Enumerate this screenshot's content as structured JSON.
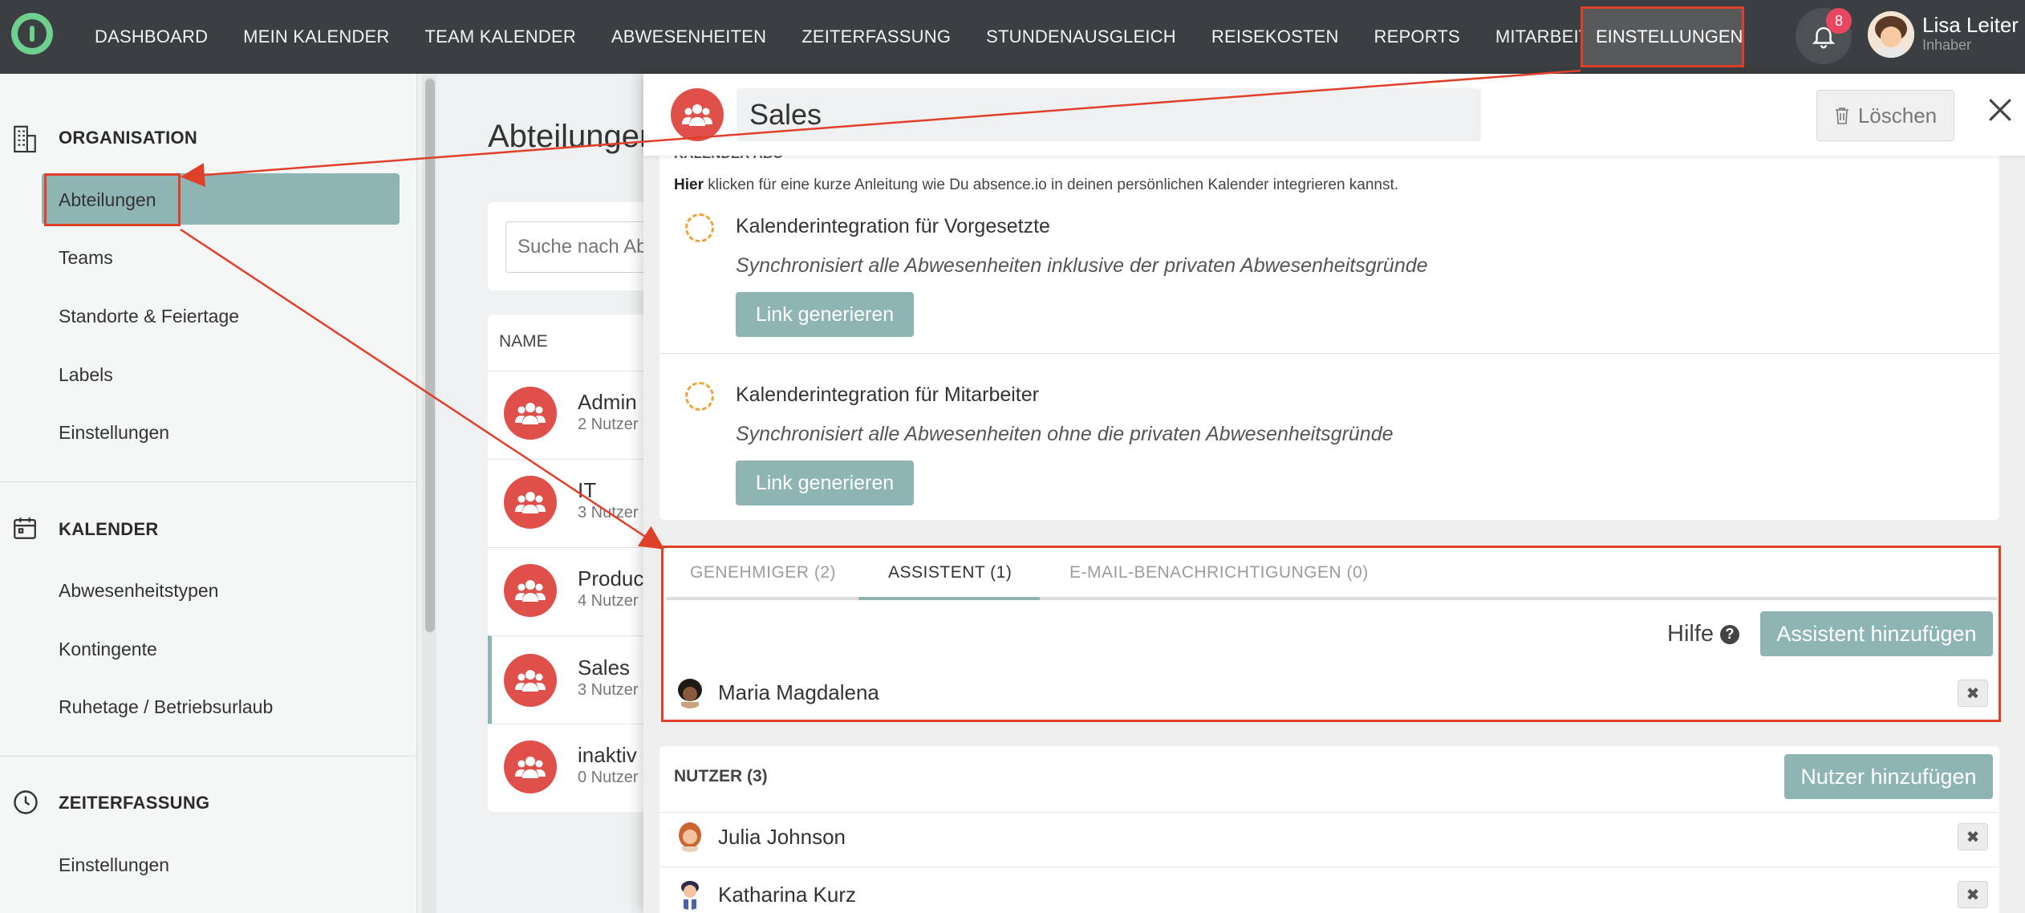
{
  "topbar": {
    "nav": [
      "DASHBOARD",
      "MEIN KALENDER",
      "TEAM KALENDER",
      "ABWESENHEITEN",
      "ZEITERFASSUNG",
      "STUNDENAUSGLEICH",
      "REISEKOSTEN",
      "REPORTS",
      "MITARBEITER"
    ],
    "settings_label": "EINSTELLUNGEN",
    "notification_count": "8",
    "user_name": "Lisa Leiter",
    "user_role": "Inhaber"
  },
  "sidebar": {
    "organisation_label": "ORGANISATION",
    "organisation_items": [
      "Abteilungen",
      "Teams",
      "Standorte & Feiertage",
      "Labels",
      "Einstellungen"
    ],
    "kalender_label": "KALENDER",
    "kalender_items": [
      "Abwesenheitstypen",
      "Kontingente",
      "Ruhetage / Betriebsurlaub"
    ],
    "zeiterfassung_label": "ZEITERFASSUNG",
    "zeiterfassung_items": [
      "Einstellungen"
    ]
  },
  "main": {
    "page_title": "Abteilungen",
    "search_placeholder": "Suche nach Abteilungen",
    "list_header": "NAME",
    "departments": [
      {
        "name": "Admin",
        "count": "2 Nutzer"
      },
      {
        "name": "IT",
        "count": "3 Nutzer"
      },
      {
        "name": "Product",
        "count": "4 Nutzer"
      },
      {
        "name": "Sales",
        "count": "3 Nutzer"
      },
      {
        "name": "inaktiv",
        "count": "0 Nutzer"
      }
    ]
  },
  "panel": {
    "title": "Sales",
    "delete_label": "Löschen",
    "calendar_section_label": "KALENDER ABO",
    "calendar_hint_bold": "Hier",
    "calendar_hint_rest": " klicken für eine kurze Anleitung wie Du absence.io in deinen persönlichen Kalender integrieren kannst.",
    "integrations": [
      {
        "title": "Kalenderintegration für Vorgesetzte",
        "desc": "Synchronisiert alle Abwesenheiten inklusive der privaten Abwesenheitsgründe",
        "button": "Link generieren"
      },
      {
        "title": "Kalenderintegration für Mitarbeiter",
        "desc": "Synchronisiert alle Abwesenheiten ohne die privaten Abwesenheitsgründe",
        "button": "Link generieren"
      }
    ],
    "tabs": [
      "GENEHMIGER  (2)",
      "ASSISTENT  (1)",
      "E-MAIL-BENACHRICHTIGUNGEN  (0)"
    ],
    "active_tab": "ASSISTENT  (1)",
    "help_label": "Hilfe",
    "add_assistant_label": "Assistent hinzufügen",
    "assistants": [
      "Maria Magdalena"
    ],
    "users_header": "NUTZER (3)",
    "add_user_label": "Nutzer hinzufügen",
    "users": [
      "Julia Johnson",
      "Katharina Kurz"
    ],
    "remove_symbol": "✖"
  },
  "colors": {
    "accent_teal": "#8fb4b4",
    "department_red": "#e0504a",
    "annotation_red": "#e0402a",
    "topbar": "#3c3f41"
  }
}
